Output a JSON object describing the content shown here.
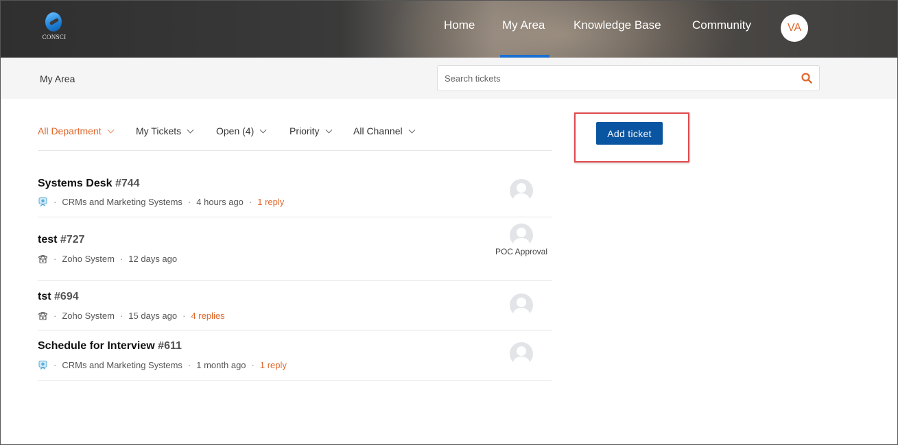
{
  "brand": {
    "logo_text": "CONSCI"
  },
  "nav": {
    "home": "Home",
    "my_area": "My Area",
    "knowledge_base": "Knowledge Base",
    "community": "Community",
    "avatar_initials": "VA"
  },
  "subbar": {
    "title": "My Area",
    "search_placeholder": "Search tickets"
  },
  "filters": {
    "department": "All Department",
    "tickets": "My Tickets",
    "status": "Open (4)",
    "priority": "Priority",
    "channel": "All Channel"
  },
  "actions": {
    "add_ticket": "Add ticket"
  },
  "tickets": [
    {
      "title": "Systems Desk",
      "number": "#744",
      "channel_icon": "web-icon",
      "department": "CRMs and Marketing Systems",
      "time": "4 hours ago",
      "replies": "1 reply",
      "assignee": ""
    },
    {
      "title": "test",
      "number": "#727",
      "channel_icon": "phone-icon",
      "department": "Zoho System",
      "time": "12 days ago",
      "replies": "",
      "assignee": "POC Approval"
    },
    {
      "title": "tst",
      "number": "#694",
      "channel_icon": "phone-icon",
      "department": "Zoho System",
      "time": "15 days ago",
      "replies": "4 replies",
      "assignee": ""
    },
    {
      "title": "Schedule for Interview",
      "number": "#611",
      "channel_icon": "web-icon",
      "department": "CRMs and Marketing Systems",
      "time": "1 month ago",
      "replies": "1 reply",
      "assignee": ""
    }
  ],
  "colors": {
    "accent": "#e0662a",
    "primary_button": "#0a55a1",
    "nav_underline": "#1a6fd0",
    "highlight_box": "#e0474c"
  }
}
